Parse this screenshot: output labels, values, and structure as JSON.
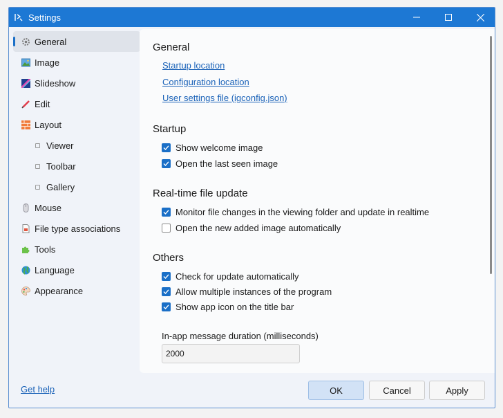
{
  "window": {
    "title": "Settings"
  },
  "sidebar": {
    "items": [
      {
        "label": "General",
        "icon": "gear-icon"
      },
      {
        "label": "Image",
        "icon": "image-icon"
      },
      {
        "label": "Slideshow",
        "icon": "slideshow-icon"
      },
      {
        "label": "Edit",
        "icon": "pencil-icon"
      },
      {
        "label": "Layout",
        "icon": "layout-icon"
      },
      {
        "label": "Viewer"
      },
      {
        "label": "Toolbar"
      },
      {
        "label": "Gallery"
      },
      {
        "label": "Mouse",
        "icon": "mouse-icon"
      },
      {
        "label": "File type associations",
        "icon": "file-icon"
      },
      {
        "label": "Tools",
        "icon": "puzzle-icon"
      },
      {
        "label": "Language",
        "icon": "globe-icon"
      },
      {
        "label": "Appearance",
        "icon": "palette-icon"
      }
    ],
    "selected": "General"
  },
  "general": {
    "title": "General",
    "links": [
      "Startup location",
      "Configuration location",
      "User settings file (igconfig.json)"
    ]
  },
  "startup": {
    "title": "Startup",
    "options": [
      {
        "label": "Show welcome image",
        "checked": true
      },
      {
        "label": "Open the last seen image",
        "checked": true
      }
    ]
  },
  "realtime": {
    "title": "Real-time file update",
    "options": [
      {
        "label": "Monitor file changes in the viewing folder and update in realtime",
        "checked": true
      },
      {
        "label": "Open the new added image automatically",
        "checked": false
      }
    ]
  },
  "others": {
    "title": "Others",
    "options": [
      {
        "label": "Check for update automatically",
        "checked": true
      },
      {
        "label": "Allow multiple instances of the program",
        "checked": true
      },
      {
        "label": "Show app icon on the title bar",
        "checked": true
      }
    ],
    "duration_label": "In-app message duration (milliseconds)",
    "duration_value": "2000"
  },
  "footer": {
    "help_link": "Get help",
    "ok": "OK",
    "cancel": "Cancel",
    "apply": "Apply"
  },
  "colors": {
    "accent": "#1a6fc7",
    "titlebar": "#1d78d4",
    "link": "#1a62b8"
  }
}
